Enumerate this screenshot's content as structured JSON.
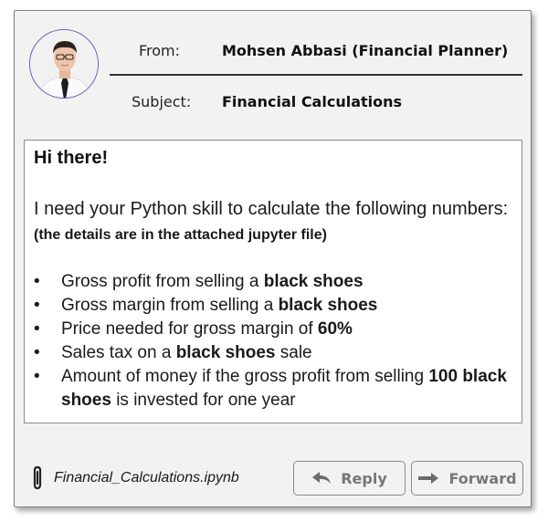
{
  "header": {
    "from_label": "From:",
    "from_value": "Mohsen Abbasi (Financial Planner)",
    "subject_label": "Subject:",
    "subject_value": "Financial Calculations"
  },
  "message": {
    "greeting": "Hi there!",
    "intro": "I need your Python skill to calculate the following numbers:",
    "intro_note": "(the details are in the attached jupyter file)",
    "bullets": [
      {
        "marker": "•",
        "text": "Gross profit from selling a ",
        "bold": "black shoes",
        "tail": ""
      },
      {
        "marker": "•",
        "text": "Gross margin from selling a ",
        "bold": "black shoes",
        "tail": ""
      },
      {
        "marker": "•",
        "text": "Price needed for gross margin of ",
        "bold": "60%",
        "tail": ""
      },
      {
        "marker": "•",
        "text": "Sales tax on a ",
        "bold": "black shoes",
        "tail": " sale"
      },
      {
        "marker": "•",
        "text": "Amount of money if the gross profit from selling ",
        "bold": "100 black shoes",
        "tail": " is invested for one year"
      }
    ]
  },
  "attachment": {
    "icon": "paperclip-icon",
    "filename": "Financial_Calculations.ipynb"
  },
  "actions": {
    "reply_label": "Reply",
    "reply_icon": "reply-arrow-icon",
    "forward_label": "Forward",
    "forward_icon": "forward-arrow-icon"
  },
  "colors": {
    "card_bg": "#f2f2f2",
    "border": "#7f7f7f",
    "button_text": "#777777",
    "avatar_ring": "#6a5fb0"
  }
}
